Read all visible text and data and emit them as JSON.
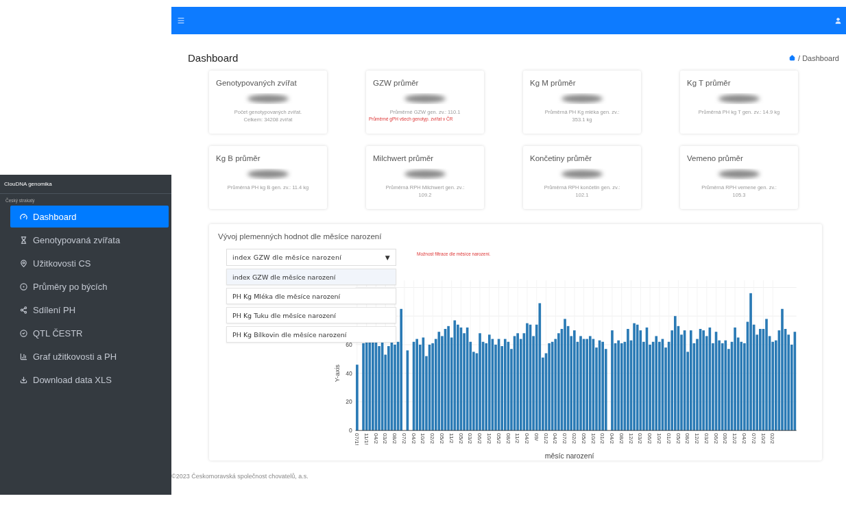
{
  "sidebar": {
    "brand": "ClouDNA genomika",
    "section": "Český strakatý",
    "items": [
      {
        "label": "Dashboard",
        "selected": true
      },
      {
        "label": "Genotypovaná zvířata",
        "selected": false
      },
      {
        "label": "Užitkovosti CS",
        "selected": false
      },
      {
        "label": "Průměry po býcích",
        "selected": false
      },
      {
        "label": "Sdílení PH",
        "selected": false
      },
      {
        "label": "QTL ČESTR",
        "selected": false
      },
      {
        "label": "Graf užitkovosti a PH",
        "selected": false
      },
      {
        "label": "Download data XLS",
        "selected": false
      }
    ]
  },
  "page": {
    "title": "Dashboard",
    "breadcrumb": "/ Dashboard"
  },
  "cards": [
    {
      "title": "Genotypovaných zvířat",
      "caption": "Počet genotypovaných zvířat.\nCelkem: 34208 zvířat"
    },
    {
      "title": "GZW průměr",
      "caption": "Průměrné GZW gen. zv.: 110.1",
      "note": "Průměrné gPH všech genotyp. zvířat v ČR"
    },
    {
      "title": "Kg M průměr",
      "caption": "Průměrná PH Kg mléka gen. zv.:\n353.1 kg"
    },
    {
      "title": "Kg T průměr",
      "caption": "Průměrná PH kg T gen. zv.: 14.9 kg"
    },
    {
      "title": "Kg B průměr",
      "caption": "Průměrná PH kg B gen. zv.: 11.4 kg"
    },
    {
      "title": "Milchwert průměr",
      "caption": "Průměrná RPH Milchwert gen. zv.:\n109.2"
    },
    {
      "title": "Končetiny průměr",
      "caption": "Průměrná RPH končetin gen. zv.:\n102.1"
    },
    {
      "title": "Vemeno průměr",
      "caption": "Průměrná RPH vemene gen. zv.:\n105.3"
    }
  ],
  "chart_panel": {
    "title": "Vývoj plemenných hodnot dle měsíce narození",
    "select_value": "index GZW dle měsíce narození",
    "caret": "▼",
    "note": "Možnost filtrace dle měsíce narození.",
    "options": [
      {
        "label": "index GZW dle měsíce narození",
        "selected": true
      },
      {
        "label": "PH Kg Mléka dle měsíce narození",
        "selected": false
      },
      {
        "label": "PH Kg Tuku dle měsíce narození",
        "selected": false
      },
      {
        "label": "PH Kg Bílkovin dle měsíce narození",
        "selected": false
      }
    ],
    "chart_data": {
      "type": "bar",
      "xlabel": "měsíc narození",
      "ylabel": "Y-axis",
      "ylim": [
        0,
        105
      ],
      "yticks": [
        0,
        20,
        40,
        60
      ],
      "grid": true,
      "categories": [
        "07/1!",
        null,
        null,
        "11/1!",
        null,
        null,
        "04/2",
        null,
        null,
        "03/2",
        null,
        null,
        "08/2",
        null,
        null,
        "07/2",
        null,
        null,
        "04/2",
        null,
        null,
        "10/2",
        null,
        null,
        "02/2",
        null,
        null,
        "05/2",
        null,
        null,
        "11/2",
        null,
        null,
        "05/2",
        null,
        null,
        "03/2",
        null,
        null,
        "06/2",
        null,
        null,
        "10/2",
        null,
        null,
        "05/2",
        null,
        null,
        "08/2",
        null,
        null,
        "11/2",
        null,
        null,
        "04/2",
        null,
        null,
        "09/",
        null,
        null,
        "01/2",
        null,
        null,
        "04/2",
        null,
        null,
        "07/2",
        null,
        null,
        "02/2",
        null,
        null,
        "05/2",
        null,
        null,
        "10/2",
        null,
        null,
        "01/2",
        null,
        null,
        "04/2",
        null,
        null,
        "08/2",
        null,
        null,
        "12/2",
        null,
        null,
        "03/2",
        null,
        null,
        "06/2",
        null,
        null,
        "10/2",
        null,
        null,
        "01/2",
        null,
        null,
        "05/2",
        null,
        null,
        "08/2",
        null,
        null,
        "12/2",
        null,
        null,
        "03/2",
        null,
        null,
        "06/2",
        null,
        null,
        "09/2",
        null,
        null,
        "12/2",
        null,
        null,
        "04/2",
        null,
        null,
        "07/2",
        null,
        null,
        "10/2",
        null,
        null,
        "02/2",
        null,
        null,
        null,
        null,
        null,
        null,
        null
      ],
      "series": [
        {
          "color": "#2a7ab5",
          "values": [
            46,
            null,
            61,
            62,
            62,
            62,
            62,
            59,
            62,
            53,
            59,
            62,
            60,
            62,
            85,
            null,
            56,
            null,
            62,
            64,
            60,
            65,
            52,
            60,
            61,
            64,
            69,
            66,
            71,
            73,
            65,
            77,
            74,
            72,
            68,
            72,
            62,
            55,
            54,
            68,
            62,
            61,
            67,
            64,
            60,
            64,
            59,
            64,
            62,
            57,
            66,
            68,
            64,
            68,
            75,
            74,
            66,
            74,
            89,
            51,
            54,
            61,
            62,
            64,
            68,
            71,
            78,
            73,
            66,
            70,
            62,
            66,
            64,
            64,
            66,
            64,
            58,
            63,
            62,
            57,
            null,
            70,
            61,
            63,
            61,
            62,
            71,
            63,
            75,
            74,
            70,
            62,
            72,
            60,
            62,
            66,
            62,
            64,
            58,
            62,
            70,
            80,
            73,
            67,
            70,
            55,
            70,
            61,
            64,
            71,
            70,
            66,
            72,
            61,
            69,
            63,
            61,
            63,
            57,
            62,
            72,
            65,
            62,
            61,
            76,
            96,
            74,
            67,
            71,
            71,
            78,
            66,
            62,
            63,
            70,
            85,
            71,
            67,
            60,
            69
          ]
        }
      ]
    }
  },
  "footer": "©2023 Českomoravská společnost chovatelů, a.s."
}
